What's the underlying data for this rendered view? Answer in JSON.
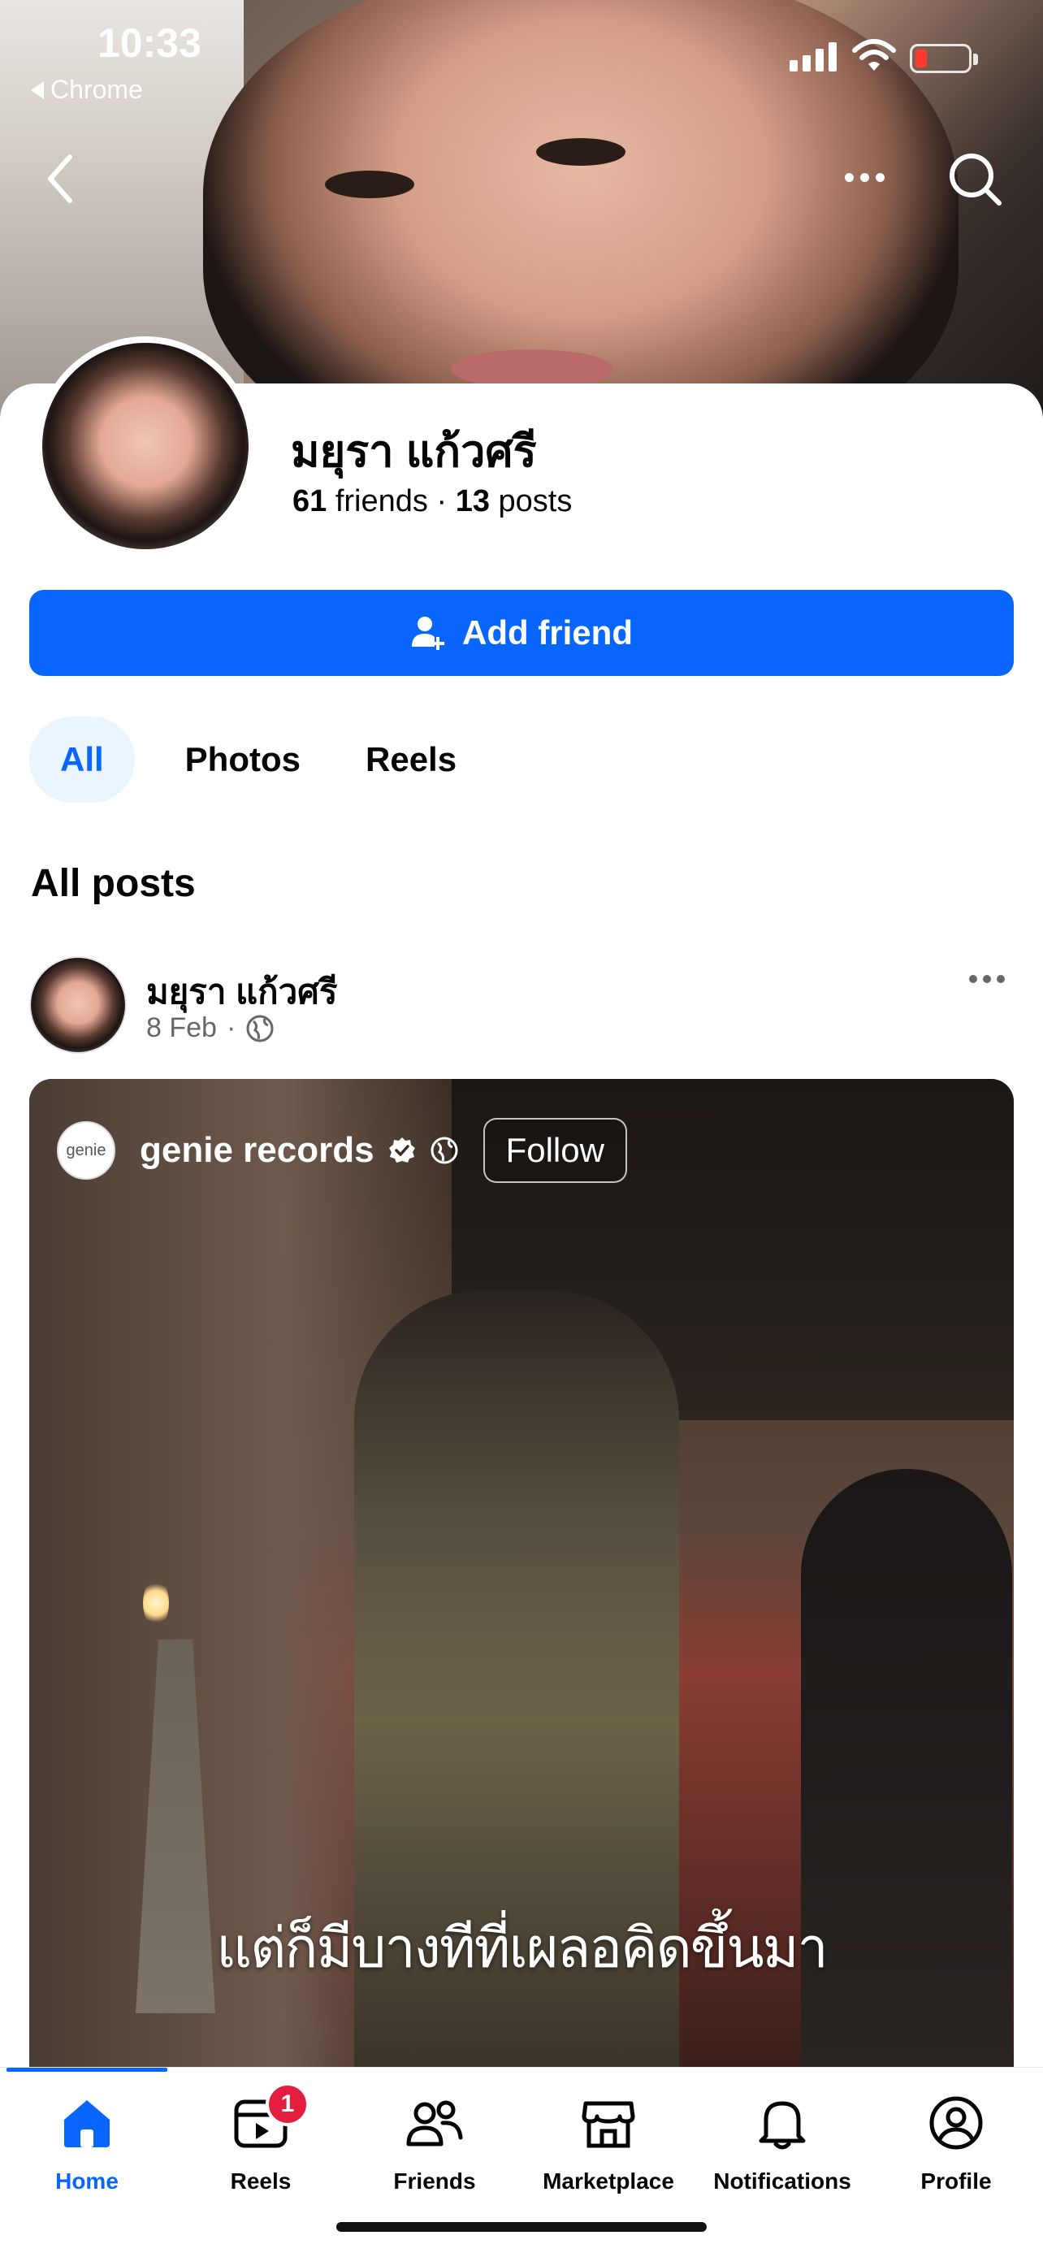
{
  "status_bar": {
    "time": "10:33",
    "back_app": "Chrome"
  },
  "profile": {
    "name": "มยุรา แก้วศรี",
    "friends_count": "61",
    "friends_label": "friends",
    "separator": "·",
    "posts_count": "13",
    "posts_label": "posts"
  },
  "actions": {
    "add_friend": "Add friend"
  },
  "tabs": [
    {
      "label": "All",
      "active": true
    },
    {
      "label": "Photos",
      "active": false
    },
    {
      "label": "Reels",
      "active": false
    }
  ],
  "section_title": "All posts",
  "post": {
    "author": "มยุรา แก้วศรี",
    "date": "8 Feb",
    "separator": "·",
    "shared": {
      "page_name": "genie records",
      "logo_text": "genie",
      "follow_label": "Follow",
      "caption": "แต่ก็มีบางทีที่เผลอคิดขึ้นมา"
    }
  },
  "bottom_nav": [
    {
      "label": "Home",
      "icon": "home-icon",
      "active": true
    },
    {
      "label": "Reels",
      "icon": "reels-icon",
      "badge": "1"
    },
    {
      "label": "Friends",
      "icon": "friends-icon"
    },
    {
      "label": "Marketplace",
      "icon": "marketplace-icon"
    },
    {
      "label": "Notifications",
      "icon": "bell-icon"
    },
    {
      "label": "Profile",
      "icon": "profile-icon"
    }
  ],
  "colors": {
    "accent": "#0866ff",
    "badge": "#e41e3f",
    "tab_active_bg": "#ebf5ff"
  }
}
